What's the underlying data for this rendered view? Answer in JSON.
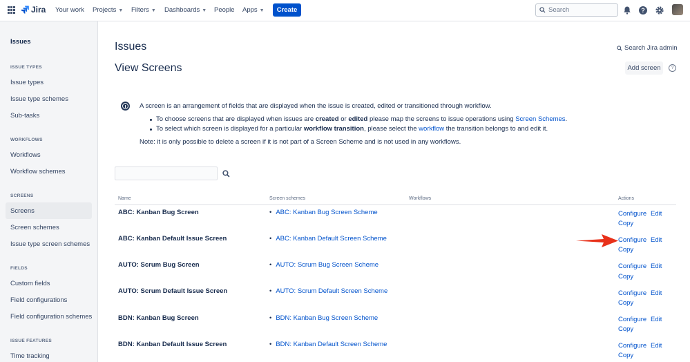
{
  "topnav": {
    "logo_text": "Jira",
    "items": [
      {
        "label": "Your work",
        "dropdown": false
      },
      {
        "label": "Projects",
        "dropdown": true
      },
      {
        "label": "Filters",
        "dropdown": true
      },
      {
        "label": "Dashboards",
        "dropdown": true
      },
      {
        "label": "People",
        "dropdown": false
      },
      {
        "label": "Apps",
        "dropdown": true
      }
    ],
    "create_label": "Create",
    "search_placeholder": "Search",
    "icons": [
      "bell-icon",
      "help-icon",
      "gear-icon",
      "avatar"
    ]
  },
  "sidebar": {
    "title": "Issues",
    "sections": [
      {
        "label": "ISSUE TYPES",
        "items": [
          "Issue types",
          "Issue type schemes",
          "Sub-tasks"
        ]
      },
      {
        "label": "WORKFLOWS",
        "items": [
          "Workflows",
          "Workflow schemes"
        ]
      },
      {
        "label": "SCREENS",
        "items": [
          "Screens",
          "Screen schemes",
          "Issue type screen schemes"
        ]
      },
      {
        "label": "FIELDS",
        "items": [
          "Custom fields",
          "Field configurations",
          "Field configuration schemes"
        ]
      },
      {
        "label": "ISSUE FEATURES",
        "items": [
          "Time tracking"
        ]
      }
    ],
    "active_item": "Screens"
  },
  "main": {
    "section_title": "Issues",
    "page_title": "View Screens",
    "admin_search_label": "Search Jira admin",
    "add_screen_label": "Add screen",
    "info": {
      "line1": "A screen is an arrangement of fields that are displayed when the issue is created, edited or transitioned through workflow.",
      "bullet1_a": "To choose screens that are displayed when issues are ",
      "bullet1_b": "created",
      "bullet1_c": " or ",
      "bullet1_d": "edited",
      "bullet1_e": " please map the screens to issue operations using ",
      "bullet1_link": "Screen Schemes",
      "bullet1_f": ".",
      "bullet2_a": "To select which screen is displayed for a particular ",
      "bullet2_b": "workflow transition",
      "bullet2_c": ", please select the ",
      "bullet2_link": "workflow",
      "bullet2_d": " the transition belongs to and edit it.",
      "note": "Note: it is only possible to delete a screen if it is not part of a Screen Scheme and is not used in any workflows."
    },
    "table": {
      "headers": [
        "Name",
        "Screen schemes",
        "Workflows",
        "Actions"
      ],
      "rows": [
        {
          "name": "ABC: Kanban Bug Screen",
          "scheme": "ABC: Kanban Bug Screen Scheme"
        },
        {
          "name": "ABC: Kanban Default Issue Screen",
          "scheme": "ABC: Kanban Default Screen Scheme"
        },
        {
          "name": "AUTO: Scrum Bug Screen",
          "scheme": "AUTO: Scrum Bug Screen Scheme"
        },
        {
          "name": "AUTO: Scrum Default Issue Screen",
          "scheme": "AUTO: Scrum Default Screen Scheme"
        },
        {
          "name": "BDN: Kanban Bug Screen",
          "scheme": "BDN: Kanban Bug Screen Scheme"
        },
        {
          "name": "BDN: Kanban Default Issue Screen",
          "scheme": "BDN: Kanban Default Screen Scheme"
        }
      ],
      "actions": {
        "configure": "Configure",
        "edit": "Edit",
        "copy": "Copy"
      }
    }
  },
  "colors": {
    "brand": "#0052cc",
    "annotation_arrow": "#e8311a"
  }
}
